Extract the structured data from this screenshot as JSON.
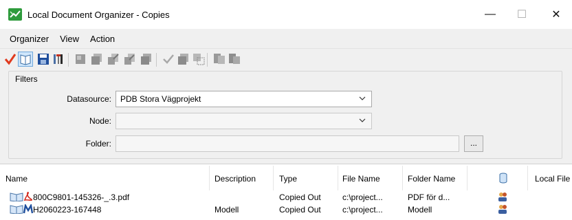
{
  "window": {
    "title": "Local Document Organizer - Copies",
    "minimize": "—",
    "maximize": "☐",
    "close": "✕"
  },
  "menu": {
    "items": [
      "Organizer",
      "View",
      "Action"
    ]
  },
  "filters": {
    "title": "Filters",
    "datasource_label": "Datasource:",
    "datasource_value": "PDB Stora Vägprojekt",
    "node_label": "Node:",
    "node_value": "",
    "folder_label": "Folder:",
    "folder_value": "",
    "browse_label": "..."
  },
  "table": {
    "columns": {
      "name": "Name",
      "description": "Description",
      "type": "Type",
      "file_name": "File Name",
      "folder_name": "Folder Name",
      "local_file": "Local File"
    },
    "rows": [
      {
        "name": "800C9801-145326-_.3.pdf",
        "description": "",
        "type": "Copied Out",
        "file_name": "c:\\project...",
        "folder_name": "PDF för d..."
      },
      {
        "name": "H2060223-167448",
        "description": "Modell",
        "type": "Copied Out",
        "file_name": "c:\\project...",
        "folder_name": "Modell"
      }
    ]
  }
}
